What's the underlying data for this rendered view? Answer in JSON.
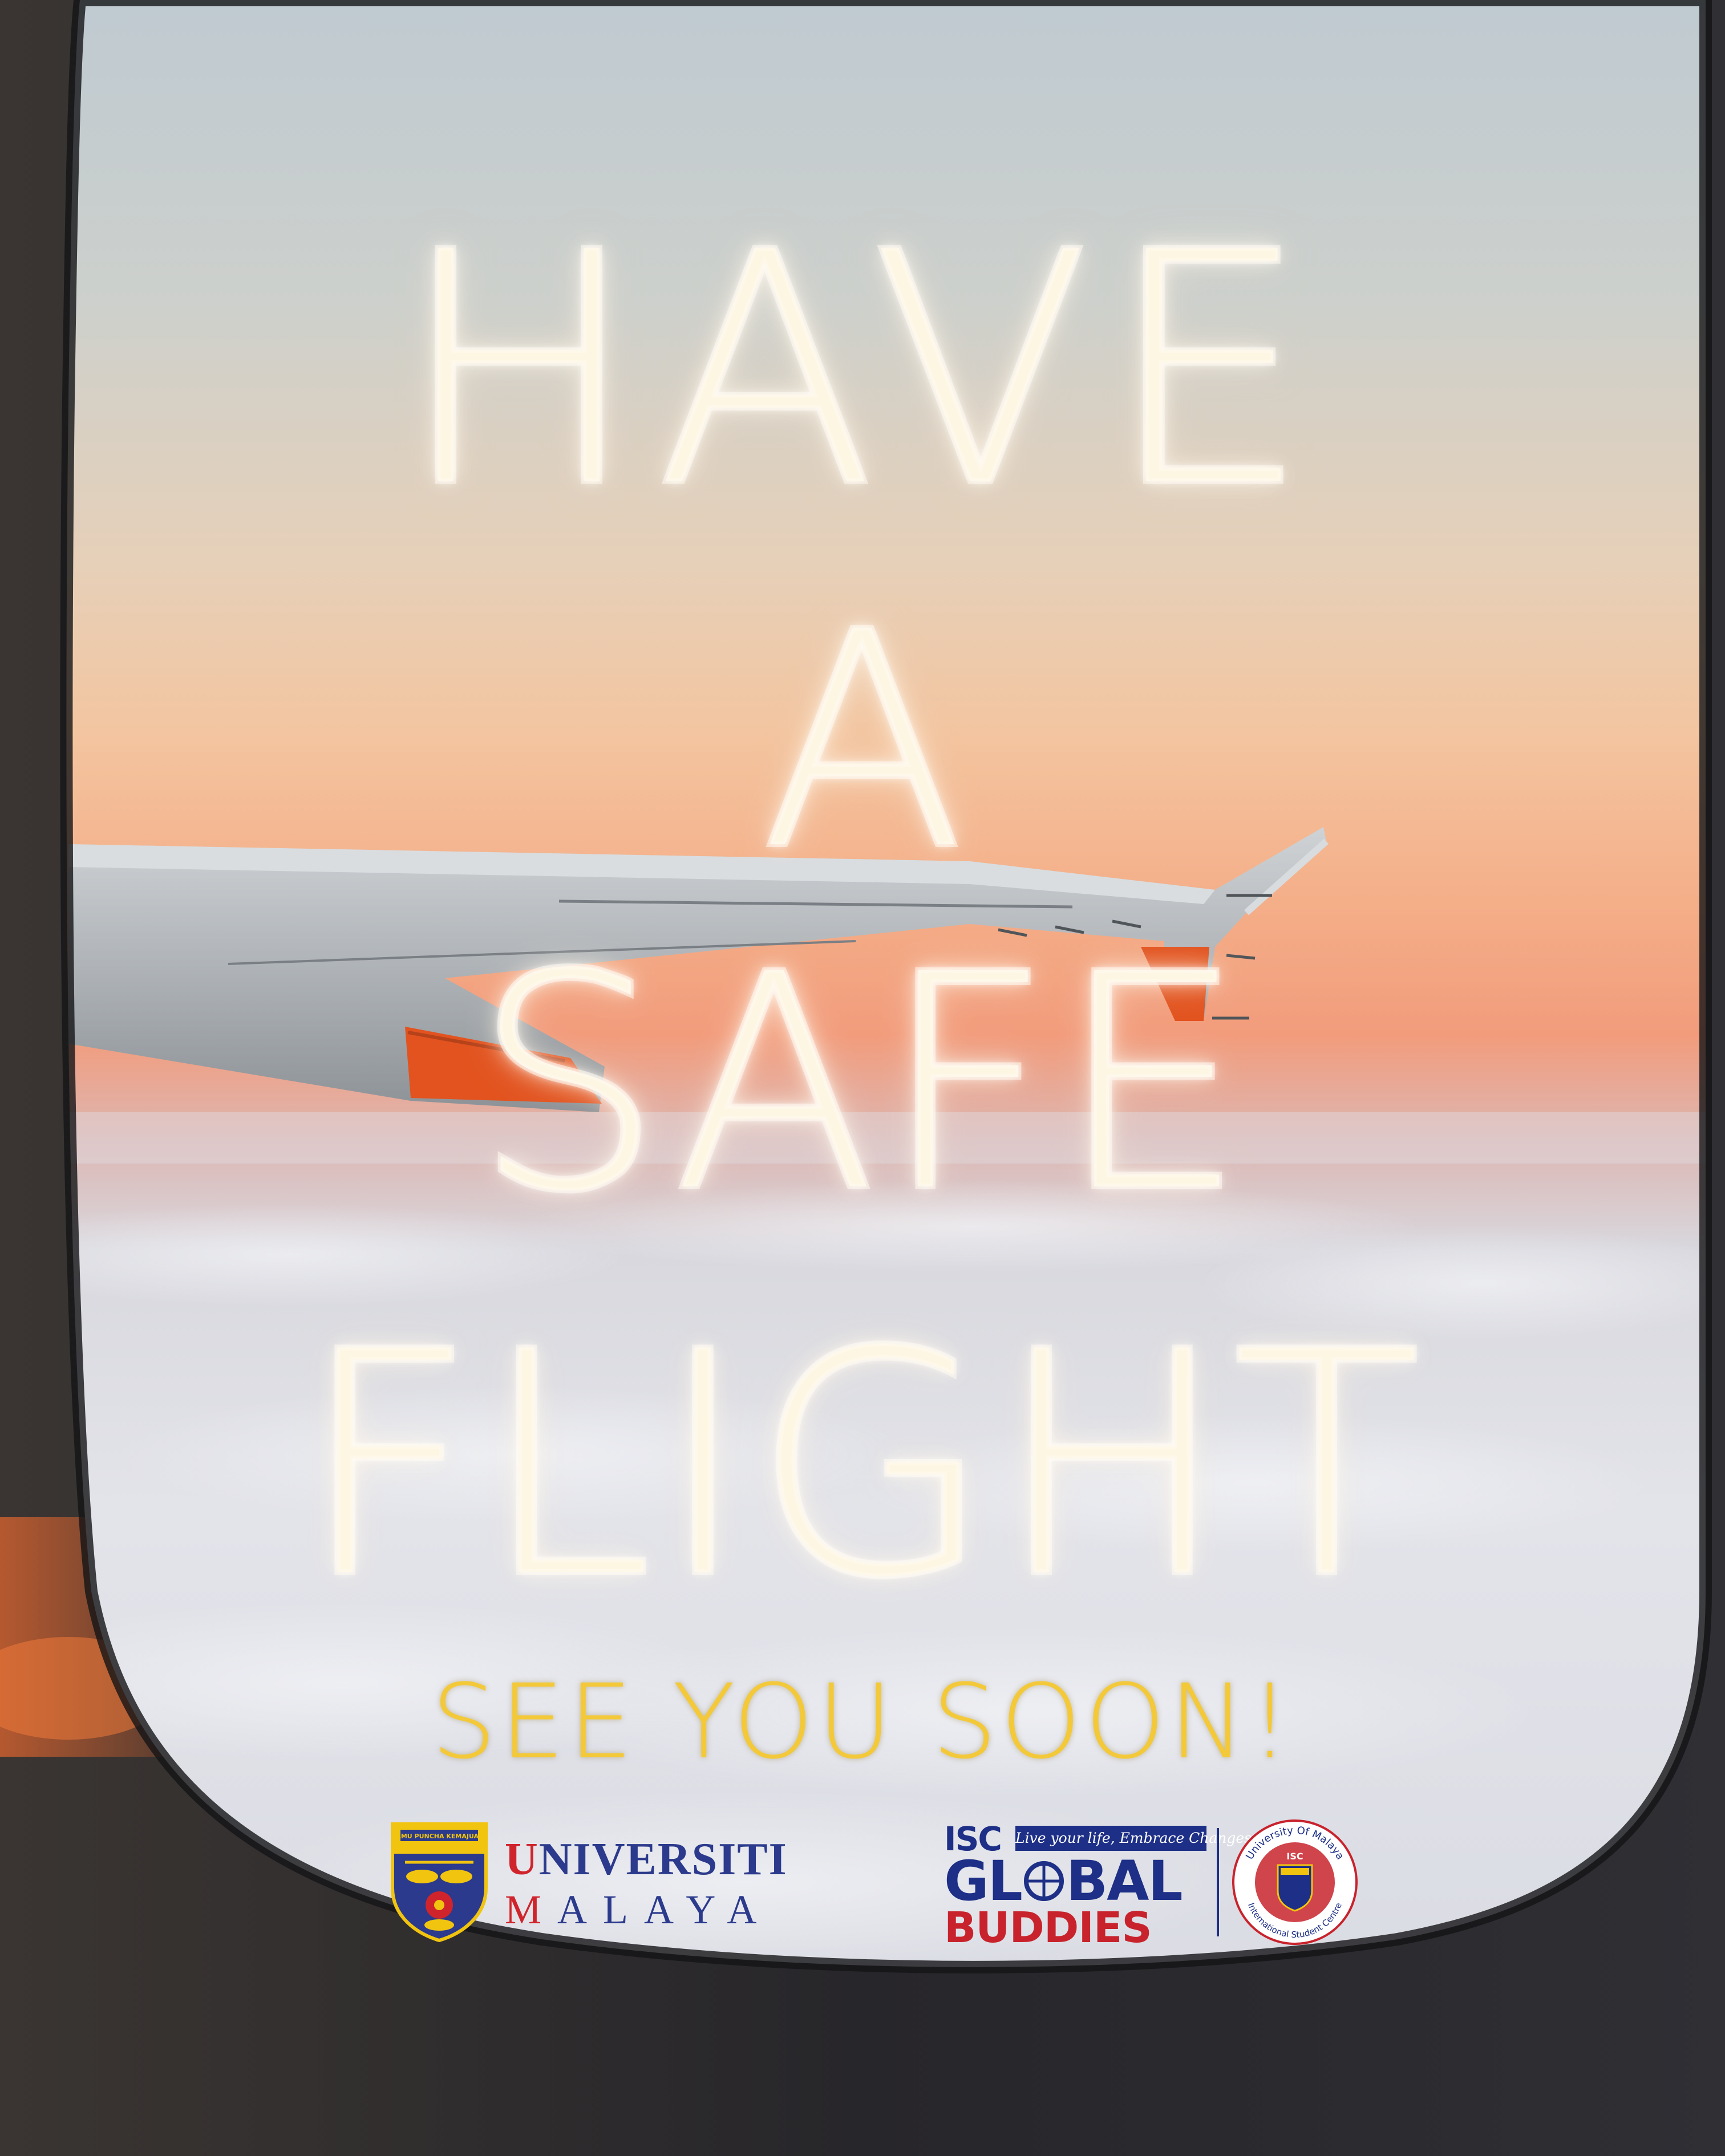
{
  "headline": {
    "line1": "HAVE",
    "line2": "A",
    "line3": "SAFE",
    "line4": "FLIGHT"
  },
  "tagline": "SEE YOU SOON!",
  "colors": {
    "sky_top": "#c2ccd2",
    "sky_peach": "#f4b98e",
    "sky_sunset": "#f2946c",
    "clouds": "#e6e8ee",
    "window_frame": "#2a2a2e",
    "wing": "#b9bdc2",
    "wing_accent": "#e2531f",
    "cloud_text": "#fdf6e3",
    "tagline": "#f3c93a",
    "um_navy": "#2b3a8c",
    "um_red": "#d0242c",
    "isc_navy": "#1d2f86",
    "isc_red": "#c8232c"
  },
  "logos": {
    "universiti_malaya": {
      "line1_first": "U",
      "line1_rest": "NIVERSITI",
      "line2_first": "M",
      "line2_rest": "ALAYA",
      "crest_motto": "ILMU PUNCHA KEMAJUAN",
      "crest_icon": "shield-crest-icon"
    },
    "isc_global_buddies": {
      "isc": "ISC",
      "slogan": "Live your life, Embrace Changes",
      "global_a": "GL",
      "global_b": "BAL",
      "buddies": "BUDDIES",
      "globe_icon": "globe-icon",
      "seal_top": "University Of Malaya",
      "seal_bottom": "International Student Centre",
      "seal_center": "ISC",
      "seal_icon": "isc-seal-icon"
    }
  }
}
